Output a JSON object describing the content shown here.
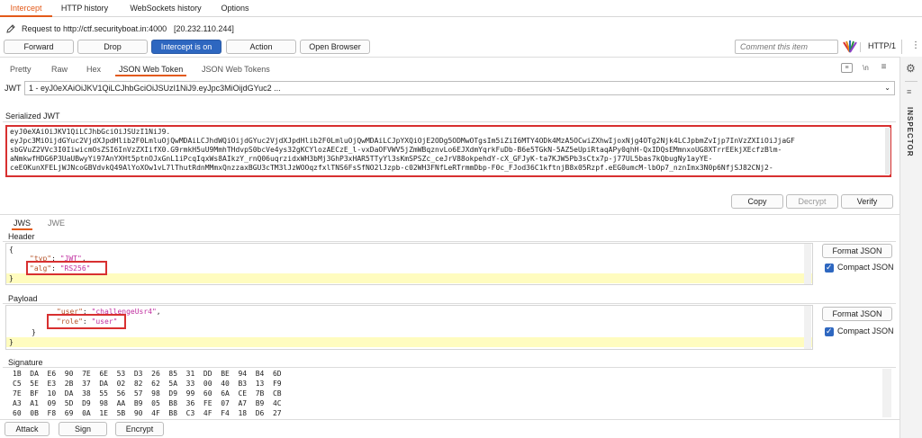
{
  "top_tabs": [
    {
      "label": "Intercept",
      "active": true
    },
    {
      "label": "HTTP history",
      "active": false
    },
    {
      "label": "WebSockets history",
      "active": false
    },
    {
      "label": "Options",
      "active": false
    }
  ],
  "request": {
    "text": "Request to http://ctf.securityboat.in:4000",
    "ip": "[20.232.110.244]"
  },
  "toolbar": {
    "forward": "Forward",
    "drop": "Drop",
    "intercept": "Intercept is on",
    "action": "Action",
    "open_browser": "Open Browser",
    "comment_placeholder": "Comment this item",
    "http_version": "HTTP/1"
  },
  "editor_tabs": [
    {
      "label": "Pretty"
    },
    {
      "label": "Raw"
    },
    {
      "label": "Hex"
    },
    {
      "label": "JSON Web Token",
      "active": true
    },
    {
      "label": "JSON Web Tokens"
    }
  ],
  "jwt": {
    "label": "JWT",
    "selected": "1 - eyJ0eXAiOiJKV1QiLCJhbGciOiJSUzI1NiJ9.eyJpc3MiOijdGYuc2 ...",
    "serialized_title": "Serialized JWT",
    "serialized_lines": [
      "eyJ0eXAiOiJKV1QiLCJhbGciOiJSUzI1NiJ9.",
      "eyJpc3MiOijdGYuc2VjdXJpdHlib2F0LmluOjQwMDAiLCJhdWQiOijdGYuc2VjdXJpdHlib2F0LmluOjQwMDAiLCJpYXQiOjE2ODg5ODMwOTgsIm5iZiI6MTY4ODk4MzA5OCwiZXhwIjoxNjg4OTg2Njk4LCJpbmZvIjp7InVzZXIiOiJjaGF",
      "sbGVuZ2VVc3I0IiwicmOsZSI6InVzZXIifX0.G9rmkH5uU9MmhTHdvpS0bcVe4ys32gKCYlozAECzE_l-vxDaOFVWV5jZmWBqznvLo6EJXdmYqrkFuDb-B6e5TGkN-5AZ5eUpiRtaqAPy0qhH-QxIDQsEMmnxoUG8XTrrEEkjXEcfzBlm-",
      "aNmkwfHDG6P3UaUBwyYi97AnYXHt5ptnOJxGnL1iPcqIqxWs8AIkzY_rnQ06uqrzidxWH3bMj3GhP3xHAR5TTyYl3sKmSPSZc_ceJrV88okpehdY-cX_GFJyK-ta7KJW5Pb3sCtx7p-j77UL5bas7kQbugNy1ayYE-",
      "ceEOKunXFELjWJNcoGBVdvkQ49AlYoXOw1vL7lThutRdnMMmxQnzzaxBGU3cTM3lJzWOOqzfxlTNS6FsSfNO2lJzpb-c02WH3FNfLeRTrmmDbp-F0c_FJod36C1kftnjB8x05Rzpf.eEG0umcM-lbOp7_nznImx3N0p6NfjSJ82CNj2-"
    ],
    "copy": "Copy",
    "decrypt": "Decrypt",
    "verify": "Verify"
  },
  "section_tabs": [
    {
      "label": "JWS",
      "active": true
    },
    {
      "label": "JWE",
      "active": false
    }
  ],
  "header": {
    "title": "Header",
    "open": "{",
    "lines": [
      {
        "key": "\"typ\"",
        "value": "\"JWT\"",
        "trail": ","
      },
      {
        "key": "\"alg\"",
        "value": "\"RS256\"",
        "trail": ""
      }
    ],
    "close": "}",
    "format_json": "Format JSON",
    "compact_json": "Compact JSON"
  },
  "payload": {
    "title": "Payload",
    "lines": [
      {
        "key": "\"user\"",
        "value": "\"challengeUsr4\"",
        "trail": ","
      },
      {
        "key": "\"role\"",
        "value": "\"user\"",
        "trail": ""
      }
    ],
    "inner_close": "}",
    "close": "}",
    "format_json": "Format JSON",
    "compact_json": "Compact JSON"
  },
  "signature": {
    "title": "Signature",
    "rows": [
      "1B  DA  E6  90  7E  6E  53  D3  26  85  31  DD  BE  94  B4  6D",
      "C5  5E  E3  2B  37  DA  02  82  62  5A  33  00  40  B3  13  F9",
      "7E  BF  10  DA  38  55  56  57  98  D9  99  60  6A  CE  7B  CB",
      "A3  A1  09  5D  D9  98  AA  B9  05  B8  36  FE  07  A7  B9  4C",
      "60  0B  F8  69  0A  1E  5B  90  4F  B8  C3  4F  F4  18  D6  27"
    ]
  },
  "bottom": {
    "attack": "Attack",
    "sign": "Sign",
    "encrypt": "Encrypt"
  },
  "side": {
    "inspector": "INSPECTOR"
  },
  "colors": {
    "accent": "#e35a1a",
    "primary": "#2e67c0",
    "highlight_box": "#d83030",
    "key": "#b5532a",
    "string": "#c02fa0"
  }
}
